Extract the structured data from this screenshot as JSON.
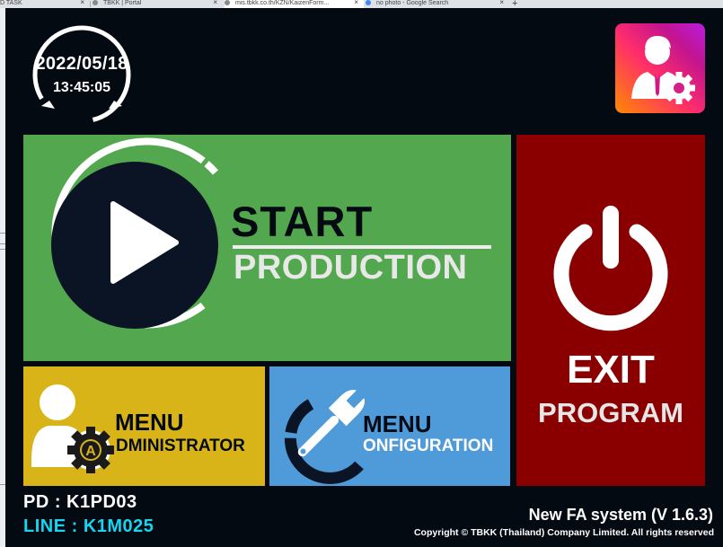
{
  "browser": {
    "tabs": [
      {
        "title": "D TASK"
      },
      {
        "title": "TBKK | Portal"
      },
      {
        "title": "mis.tbkk.co.th/KZN/KaizenForm..."
      },
      {
        "title": "no photo - Google Search"
      }
    ]
  },
  "clock": {
    "date": "2022/05/18",
    "time": "13:45:05"
  },
  "user_settings": {
    "icon": "user-settings-icon"
  },
  "tiles": {
    "start": {
      "line1": "START",
      "line2": "PRODUCTION",
      "icon": "play-icon"
    },
    "exit": {
      "line1": "EXIT",
      "line2": "PROGRAM",
      "icon": "power-icon"
    },
    "admin": {
      "line1": "MENU",
      "line2": "DMINISTRATOR",
      "badge": "A",
      "icon": "admin-user-icon"
    },
    "config": {
      "line1": "MENU",
      "line2": "ONFIGURATION",
      "icon": "wrench-icon"
    }
  },
  "footer": {
    "pd": "PD : K1PD03",
    "line": "LINE : K1M025",
    "version": "New FA system (V 1.6.3)",
    "copyright": "Copyright © TBKK (Thailand) Company Limited. All rights reserved"
  },
  "colors": {
    "background": "#040a12",
    "start": "#53a84f",
    "exit": "#8a0000",
    "admin": "#d8b418",
    "config": "#4f9ad8",
    "line_label": "#17d4f0"
  }
}
